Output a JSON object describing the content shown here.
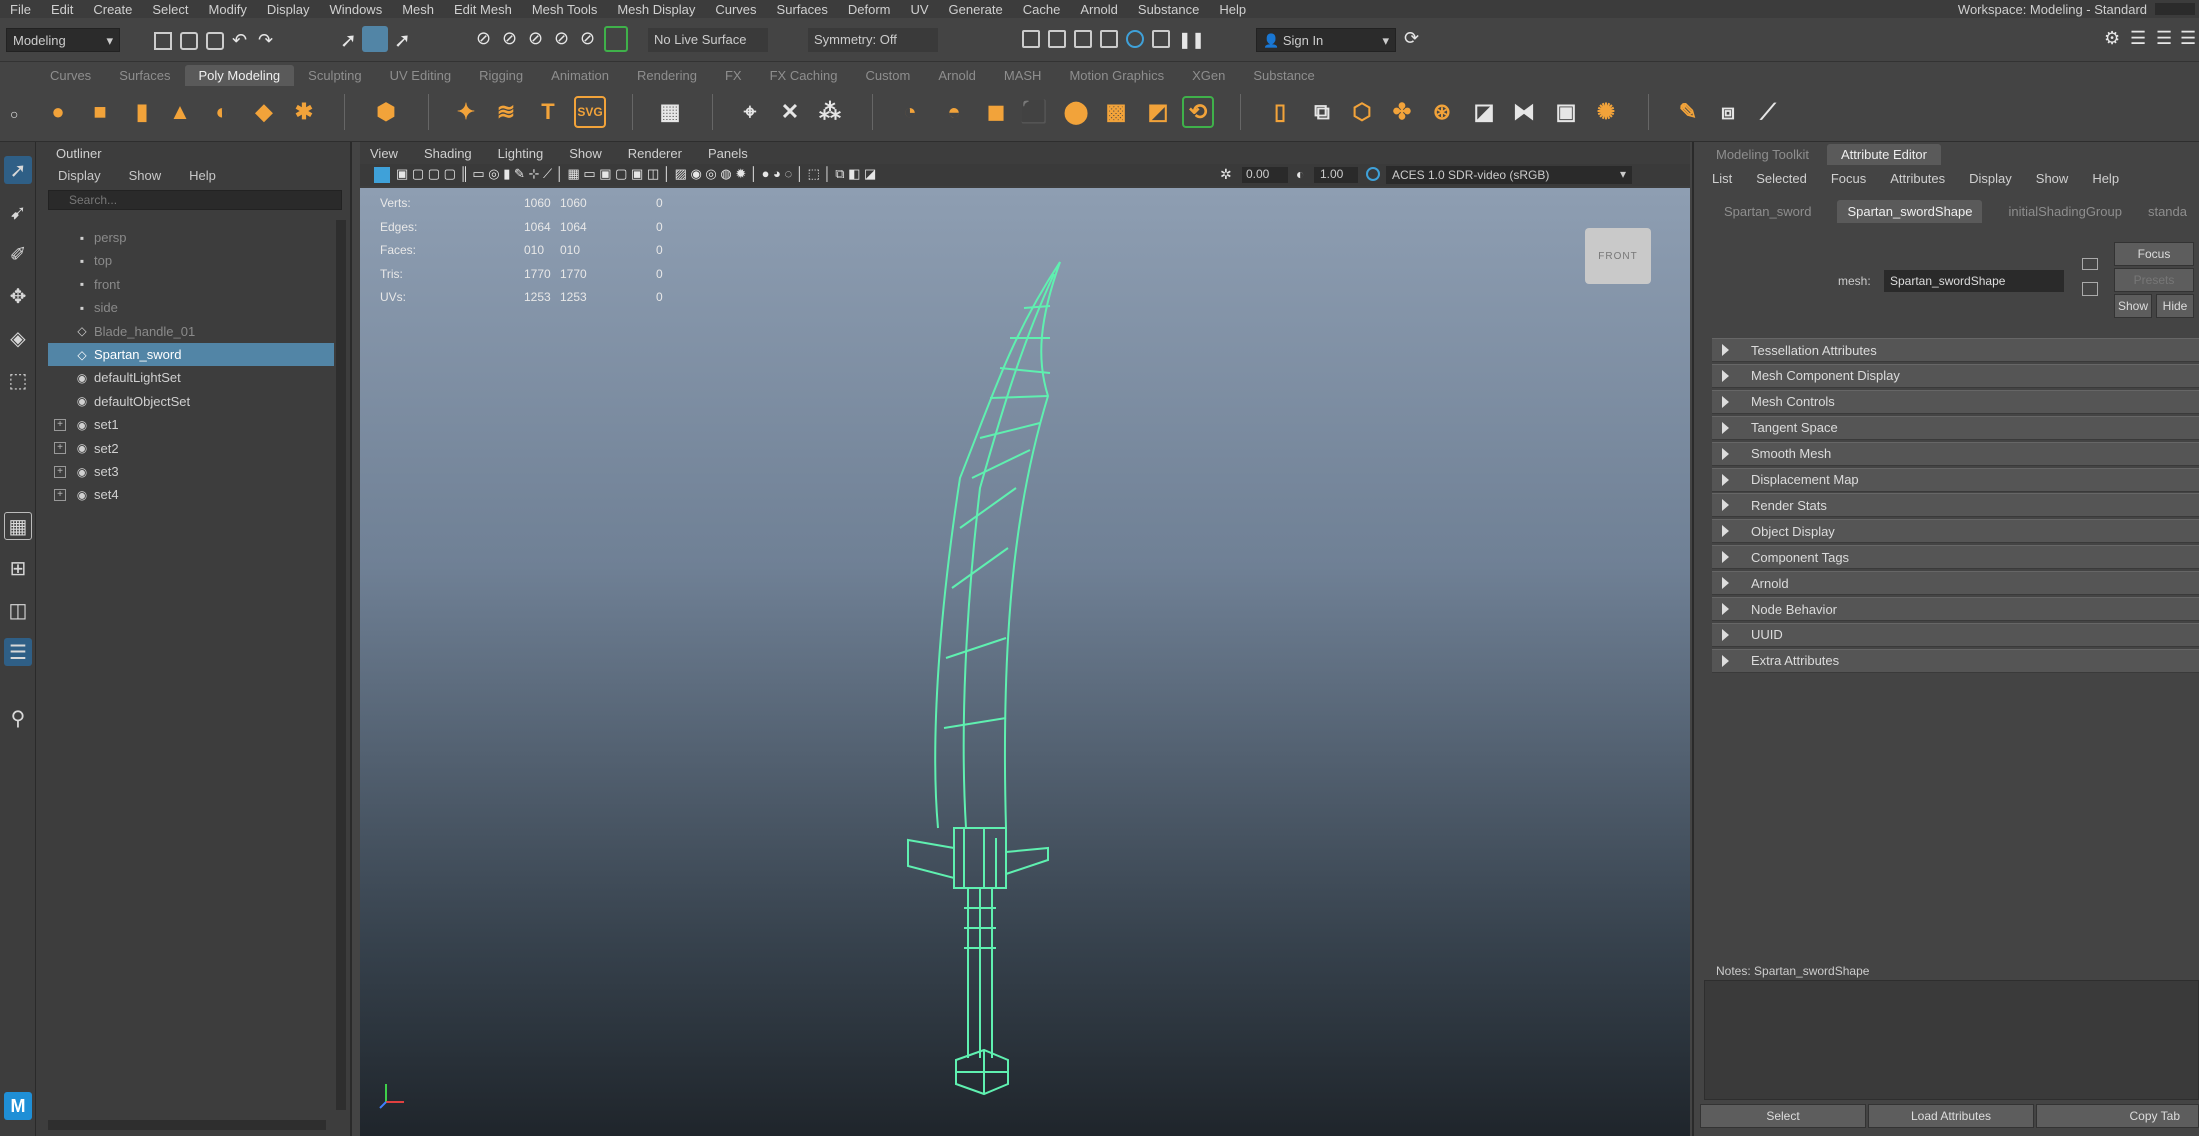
{
  "menubar": {
    "items": [
      "File",
      "Edit",
      "Create",
      "Select",
      "Modify",
      "Display",
      "Windows",
      "Mesh",
      "Edit Mesh",
      "Mesh Tools",
      "Mesh Display",
      "Curves",
      "Surfaces",
      "Deform",
      "UV",
      "Generate",
      "Cache",
      "Arnold",
      "Substance",
      "Help"
    ],
    "workspace": "Workspace: Modeling - Standard"
  },
  "statusline": {
    "mode": "Modeling",
    "live_surface": "No Live Surface",
    "symmetry": "Symmetry: Off",
    "sign_in": "Sign In"
  },
  "shelf": {
    "tabs": [
      "Curves",
      "Surfaces",
      "Poly Modeling",
      "Sculpting",
      "UV Editing",
      "Rigging",
      "Animation",
      "Rendering",
      "FX",
      "FX Caching",
      "Custom",
      "Arnold",
      "MASH",
      "Motion Graphics",
      "XGen",
      "Substance"
    ],
    "active_tab": "Poly Modeling"
  },
  "outliner": {
    "title": "Outliner",
    "menu": [
      "Display",
      "Show",
      "Help"
    ],
    "search_placeholder": "Search...",
    "items": [
      {
        "label": "persp",
        "icon": "camera-icon",
        "dim": true
      },
      {
        "label": "top",
        "icon": "camera-icon",
        "dim": true
      },
      {
        "label": "front",
        "icon": "camera-icon",
        "dim": true
      },
      {
        "label": "side",
        "icon": "camera-icon",
        "dim": true
      },
      {
        "label": "Blade_handle_01",
        "icon": "mesh-icon",
        "dim": true
      },
      {
        "label": "Spartan_sword",
        "icon": "mesh-icon",
        "selected": true
      },
      {
        "label": "defaultLightSet",
        "icon": "set-icon"
      },
      {
        "label": "defaultObjectSet",
        "icon": "set-icon"
      },
      {
        "label": "set1",
        "icon": "set-icon",
        "expand": true
      },
      {
        "label": "set2",
        "icon": "set-icon",
        "expand": true
      },
      {
        "label": "set3",
        "icon": "set-icon",
        "expand": true
      },
      {
        "label": "set4",
        "icon": "set-icon",
        "expand": true
      }
    ]
  },
  "viewport": {
    "menu": [
      "View",
      "Shading",
      "Lighting",
      "Show",
      "Renderer",
      "Panels"
    ],
    "near_clip": "0.00",
    "far_clip": "1.00",
    "color_space": "ACES 1.0 SDR-video (sRGB)",
    "hud": [
      {
        "label": "Verts:",
        "a": "1060",
        "b": "1060",
        "c": "0"
      },
      {
        "label": "Edges:",
        "a": "1064",
        "b": "1064",
        "c": "0"
      },
      {
        "label": "Faces:",
        "a": "010",
        "b": "010",
        "c": "0"
      },
      {
        "label": "Tris:",
        "a": "1770",
        "b": "1770",
        "c": "0"
      },
      {
        "label": "UVs:",
        "a": "1253",
        "b": "1253",
        "c": "0"
      }
    ],
    "view_cube": "FRONT",
    "wire_color": "#5ff0b0"
  },
  "attribute_editor": {
    "tabs": [
      "Modeling Toolkit",
      "Attribute Editor"
    ],
    "active_tab": "Attribute Editor",
    "menu": [
      "List",
      "Selected",
      "Focus",
      "Attributes",
      "Display",
      "Show",
      "Help"
    ],
    "node_tabs": [
      "Spartan_sword",
      "Spartan_swordShape",
      "initialShadingGroup",
      "standa"
    ],
    "active_node_tab": "Spartan_swordShape",
    "mesh_label": "mesh:",
    "mesh_value": "Spartan_swordShape",
    "focus_btn": "Focus",
    "presets_btn": "Presets",
    "show_btn": "Show",
    "hide_btn": "Hide",
    "sections": [
      "Tessellation Attributes",
      "Mesh Component Display",
      "Mesh Controls",
      "Tangent Space",
      "Smooth Mesh",
      "Displacement Map",
      "Render Stats",
      "Object Display",
      "Component Tags",
      "Arnold",
      "Node Behavior",
      "UUID",
      "Extra Attributes"
    ],
    "notes": "Notes: Spartan_swordShape",
    "bottom_buttons": [
      "Select",
      "Load Attributes",
      "Copy Tab"
    ]
  },
  "toolbox": {
    "logo": "M"
  }
}
